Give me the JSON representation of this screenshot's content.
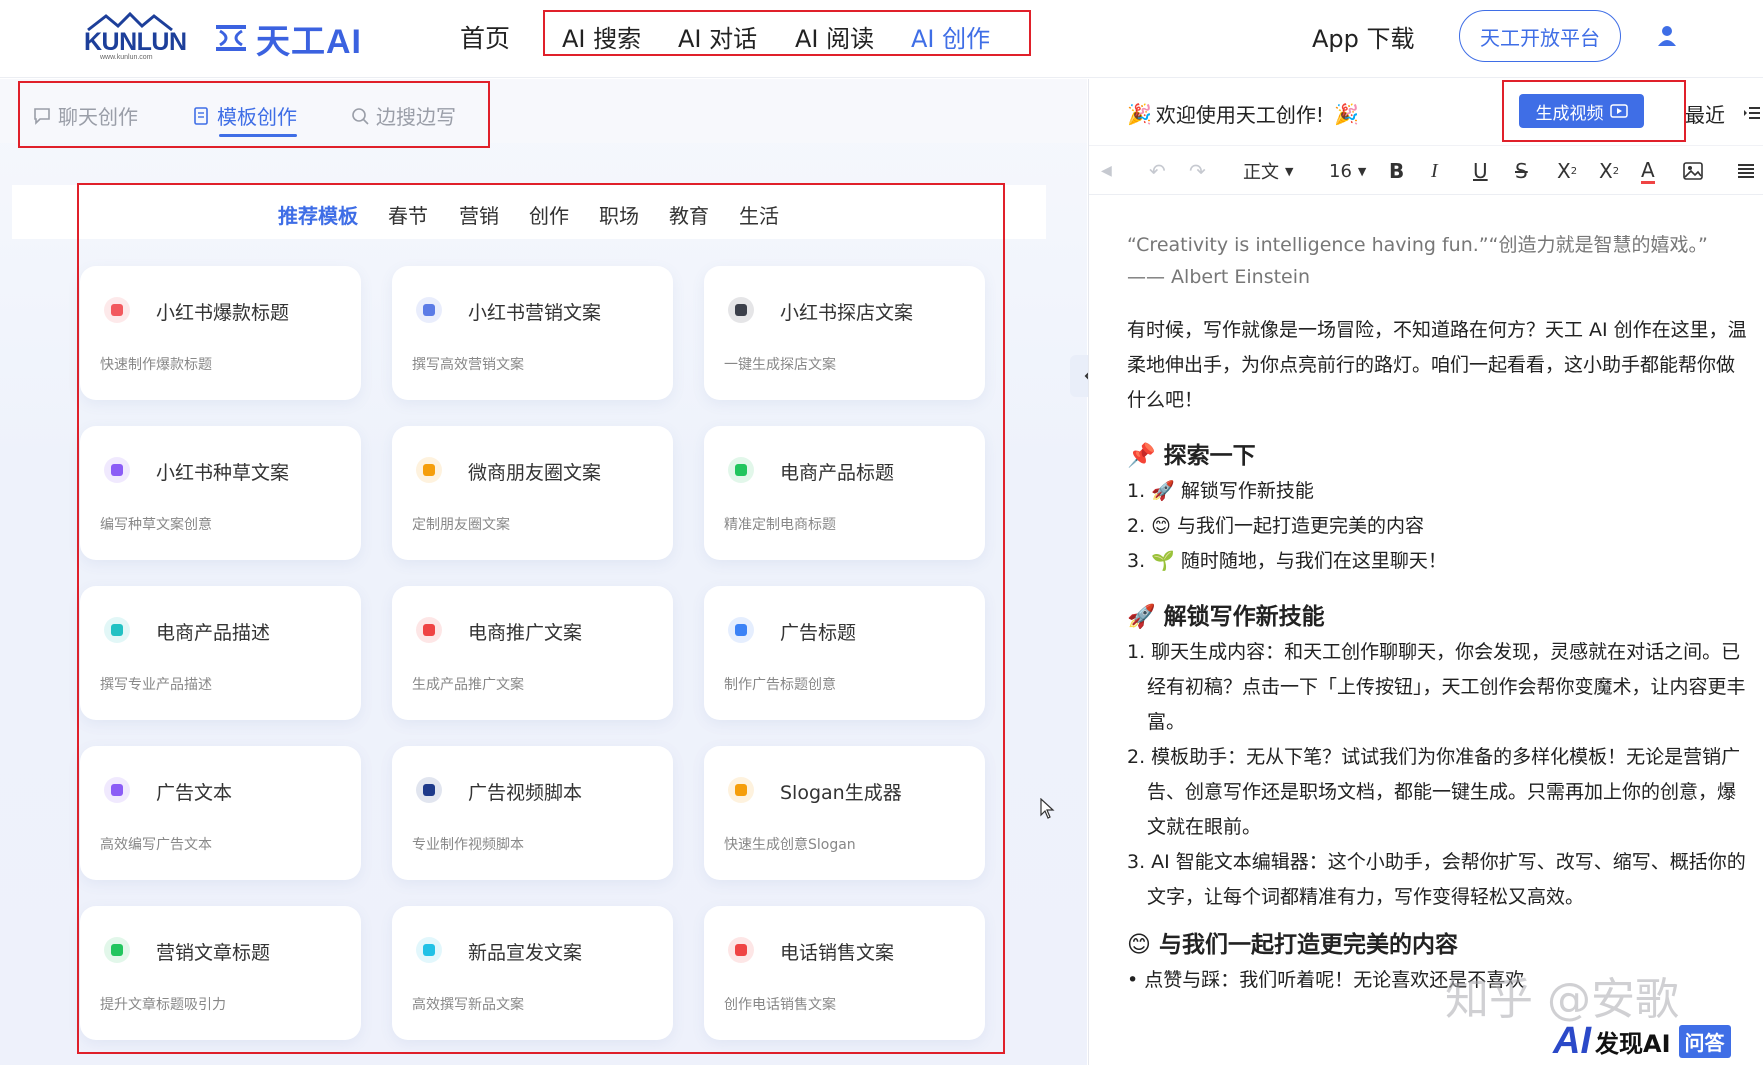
{
  "header": {
    "brand_kunlun": "KUNLUN",
    "brand_kunlun_url": "www.kunlun.com",
    "brand_name": "天工AI",
    "nav": [
      "首页",
      "AI 搜索",
      "AI 对话",
      "AI 阅读",
      "AI 创作"
    ],
    "active_nav": "AI 创作",
    "app_download": "App 下载",
    "open_platform": "天工开放平台"
  },
  "left_tabs": [
    "聊天创作",
    "模板创作",
    "边搜边写"
  ],
  "categories": [
    "推荐模板",
    "春节",
    "营销",
    "创作",
    "职场",
    "教育",
    "生活"
  ],
  "cards": [
    {
      "title": "小红书爆款标题",
      "desc": "快速制作爆款标题",
      "icon": "red-note-icon",
      "color": "#f2595e"
    },
    {
      "title": "小红书营销文案",
      "desc": "撰写高效营销文案",
      "icon": "list-chart-icon",
      "color": "#5b7be6"
    },
    {
      "title": "小红书探店文案",
      "desc": "一键生成探店文案",
      "icon": "avatar-icon",
      "color": "#3b3f4a"
    },
    {
      "title": "小红书种草文案",
      "desc": "编写种草文案创意",
      "icon": "cart-icon",
      "color": "#8b5cf6"
    },
    {
      "title": "微商朋友圈文案",
      "desc": "定制朋友圈文案",
      "icon": "circle-icon",
      "color": "#f59e0b"
    },
    {
      "title": "电商产品标题",
      "desc": "精准定制电商标题",
      "icon": "mail-icon",
      "color": "#22c55e"
    },
    {
      "title": "电商产品描述",
      "desc": "撰写专业产品描述",
      "icon": "text-icon",
      "color": "#22c1c3"
    },
    {
      "title": "电商推广文案",
      "desc": "生成产品推广文案",
      "icon": "doc-icon",
      "color": "#ef4444"
    },
    {
      "title": "广告标题",
      "desc": "制作广告标题创意",
      "icon": "doc-lines-icon",
      "color": "#3b82f6"
    },
    {
      "title": "广告文本",
      "desc": "高效编写广告文本",
      "icon": "file-icon",
      "color": "#8b5cf6"
    },
    {
      "title": "广告视频脚本",
      "desc": "专业制作视频脚本",
      "icon": "video-avatar-icon",
      "color": "#1e3a8a"
    },
    {
      "title": "Slogan生成器",
      "desc": "快速生成创意Slogan",
      "icon": "message-icon",
      "color": "#f59e0b"
    },
    {
      "title": "营销文章标题",
      "desc": "提升文章标题吸引力",
      "icon": "h-icon",
      "color": "#22c55e"
    },
    {
      "title": "新品宣发文案",
      "desc": "高效撰写新品文案",
      "icon": "file-icon",
      "color": "#22c1e6"
    },
    {
      "title": "电话销售文案",
      "desc": "创作电话销售文案",
      "icon": "phone-icon",
      "color": "#ef4444"
    }
  ],
  "right_panel": {
    "welcome": "欢迎使用天工创作!",
    "generate_video": "生成视频",
    "recent": "最近",
    "toolbar": {
      "style": "正文",
      "font_size": "16"
    },
    "quote": "“Creativity is intelligence having fun.”“创造力就是智慧的嬉戏。”",
    "quote_author": "—— Albert Einstein",
    "intro": "有时候，写作就像是一场冒险，不知道路在何方？天工 AI 创作在这里，温柔地伸出手，为你点亮前行的路灯。咱们一起看看，这小助手都能帮你做什么吧！",
    "section1_title": "探索一下",
    "section1_items": [
      "1. 🚀 解锁写作新技能",
      "2. 😊 与我们一起打造更完美的内容",
      "3. 🌱 随时随地，与我们在这里聊天！"
    ],
    "section2_title": "解锁写作新技能",
    "section2_items": [
      "1. 聊天生成内容：和天工创作聊聊天，你会发现，灵感就在对话之间。已经有初稿？点击一下「上传按钮」，天工创作会帮你变魔术，让内容更丰富。",
      "2. 模板助手：无从下笔？试试我们为你准备的多样化模板！无论是营销广告、创意写作还是职场文档，都能一键生成。只需再加上你的创意，爆文就在眼前。",
      "3. AI 智能文本编辑器：这个小助手，会帮你扩写、改写、缩写、概括你的文字，让每个词都精准有力，写作变得轻松又高效。"
    ],
    "section3_title": "与我们一起打造更完美的内容",
    "section3_item": "• 点赞与踩：我们听着呢！无论喜欢还是不喜欢"
  },
  "watermark": {
    "zhihu": "知乎 @安歌",
    "faxian": "发现AI",
    "wenda": "问答"
  }
}
